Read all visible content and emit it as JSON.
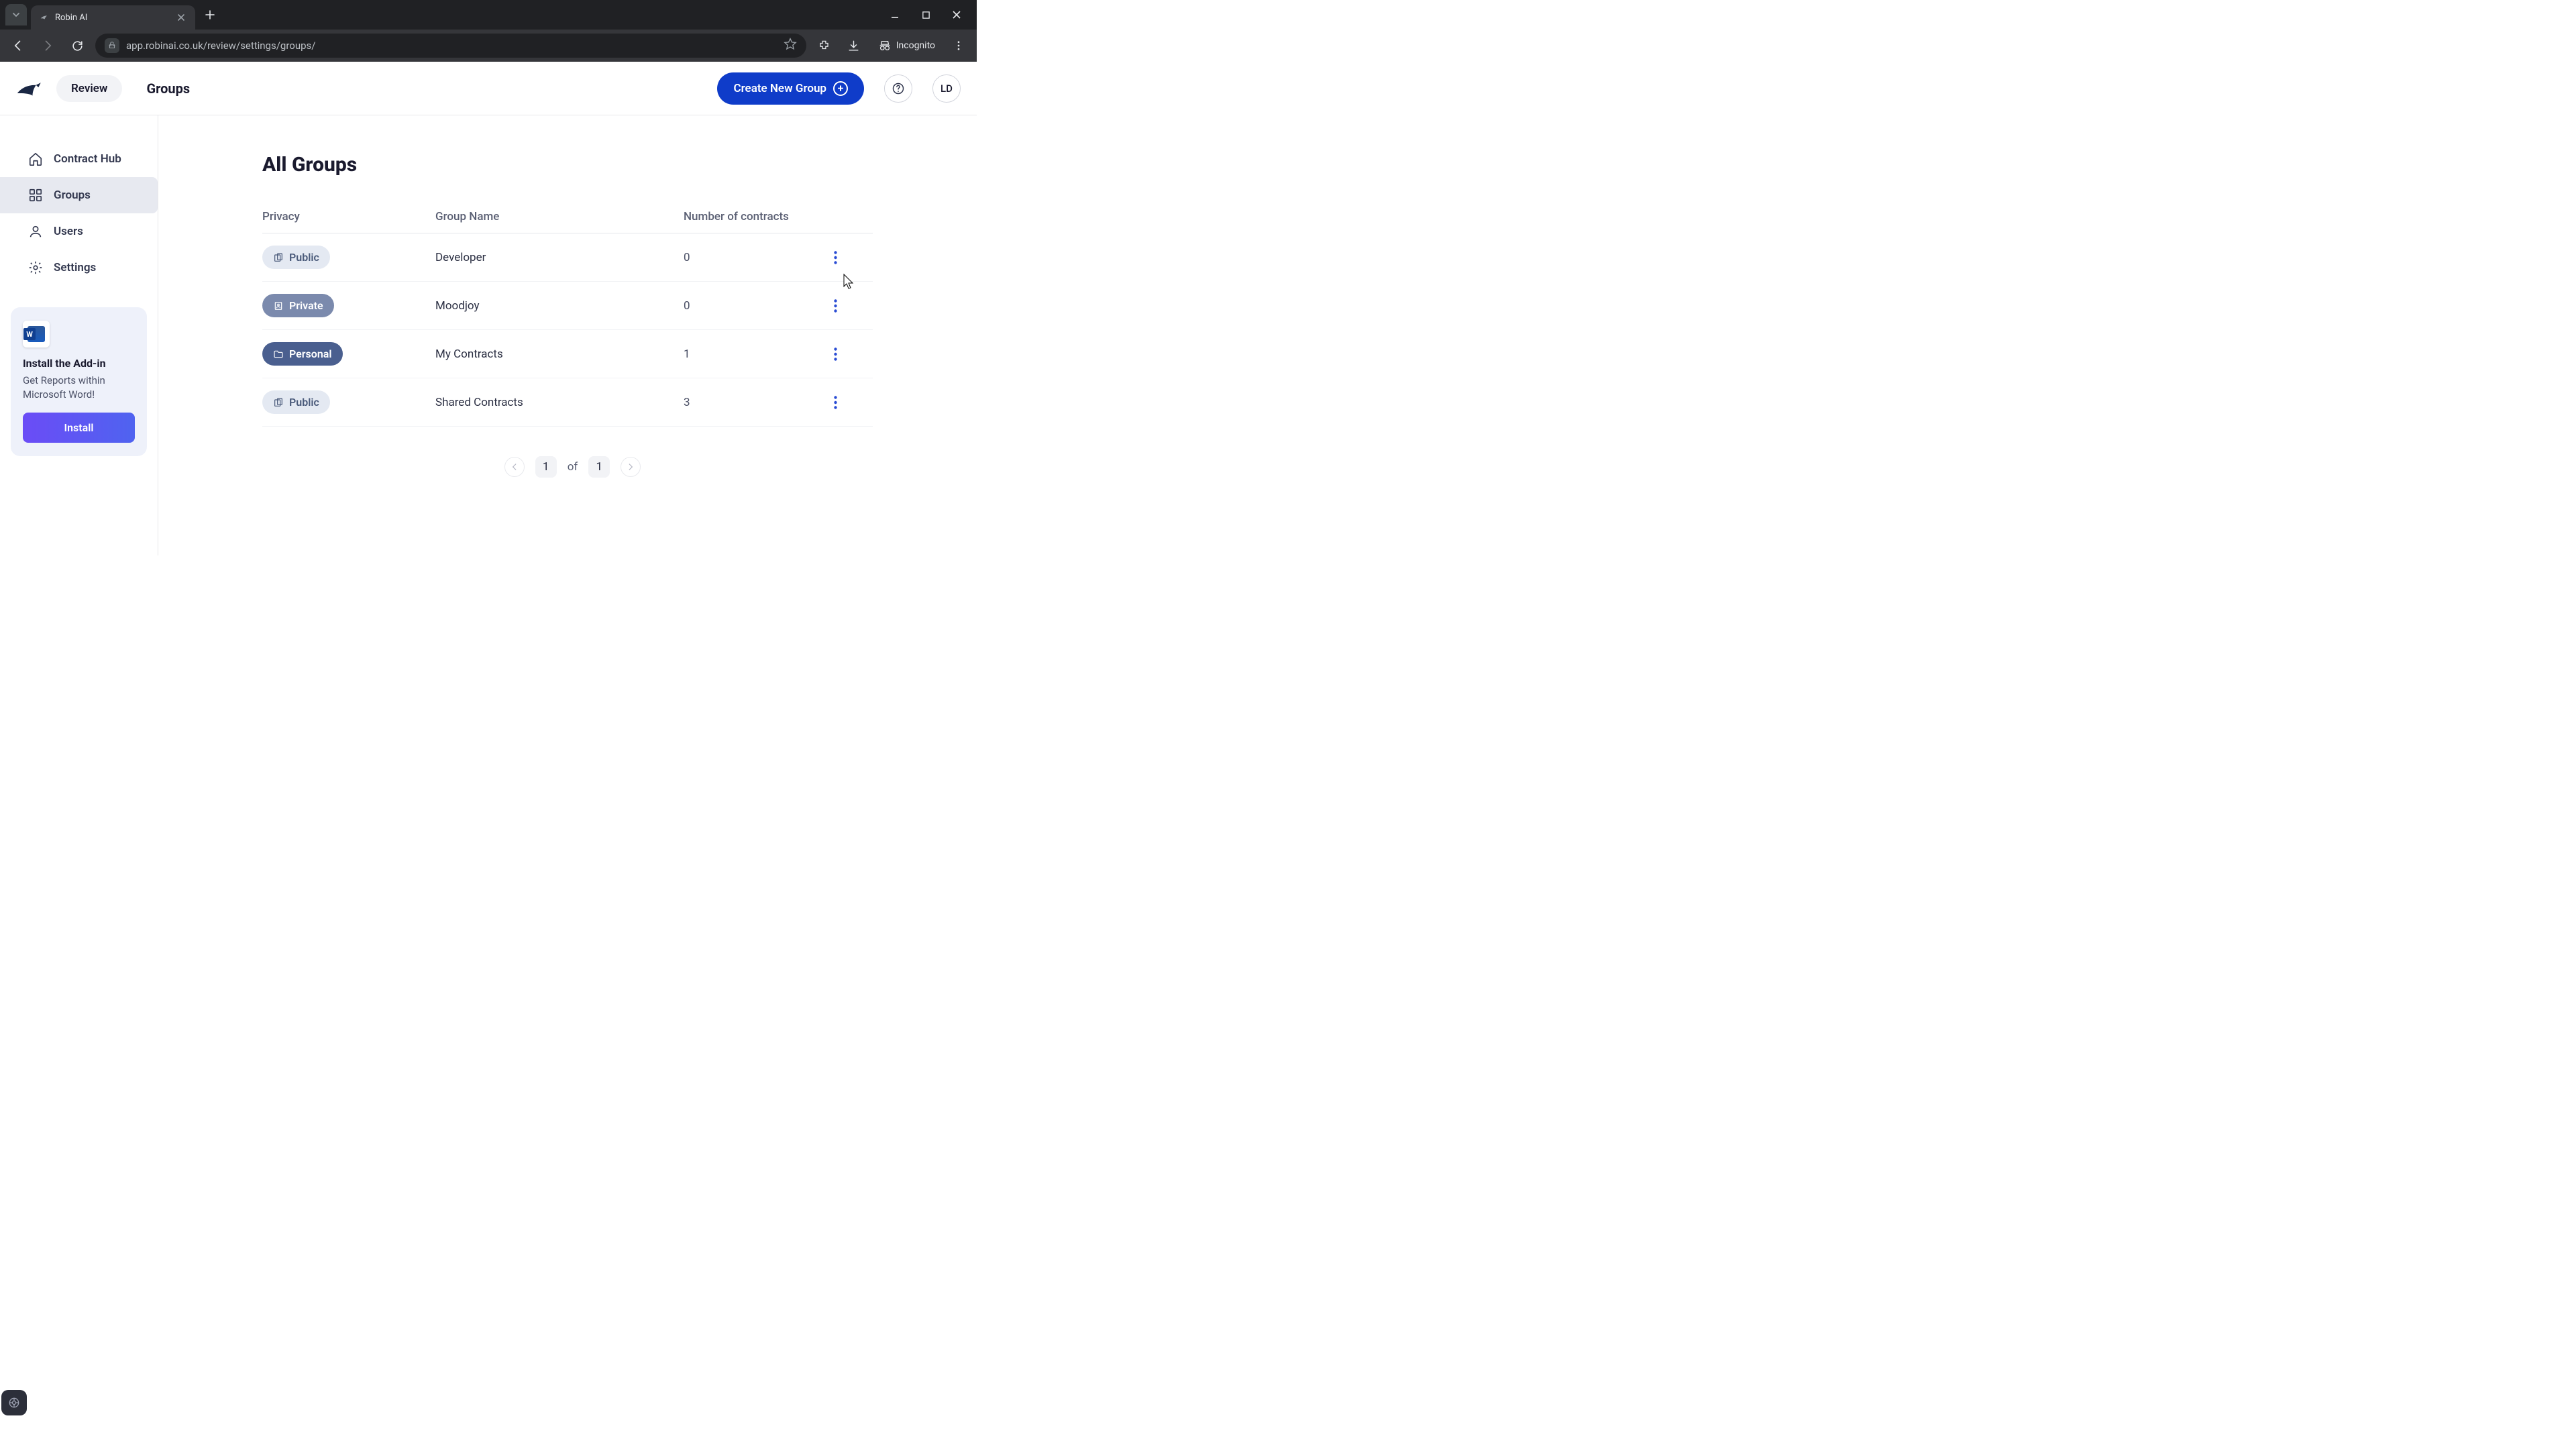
{
  "browser": {
    "tab_title": "Robin AI",
    "url_display": "app.robinai.co.uk/review/settings/groups/",
    "incognito_label": "Incognito"
  },
  "header": {
    "review_label": "Review",
    "page_title": "Groups",
    "create_button": "Create New Group",
    "avatar_initials": "LD"
  },
  "sidebar": {
    "items": [
      {
        "label": "Contract Hub"
      },
      {
        "label": "Groups"
      },
      {
        "label": "Users"
      },
      {
        "label": "Settings"
      }
    ]
  },
  "promo": {
    "title": "Install the Add-in",
    "subtitle": "Get Reports within Microsoft Word!",
    "button": "Install"
  },
  "main": {
    "title": "All Groups",
    "columns": {
      "privacy": "Privacy",
      "group_name": "Group Name",
      "contracts": "Number of contracts"
    },
    "rows": [
      {
        "privacy": "Public",
        "badge_type": "public",
        "name": "Developer",
        "count": "0"
      },
      {
        "privacy": "Private",
        "badge_type": "private",
        "name": "Moodjoy",
        "count": "0"
      },
      {
        "privacy": "Personal",
        "badge_type": "personal",
        "name": "My Contracts",
        "count": "1"
      },
      {
        "privacy": "Public",
        "badge_type": "public",
        "name": "Shared Contracts",
        "count": "3"
      }
    ]
  },
  "pagination": {
    "current": "1",
    "of_label": "of",
    "total": "1"
  }
}
